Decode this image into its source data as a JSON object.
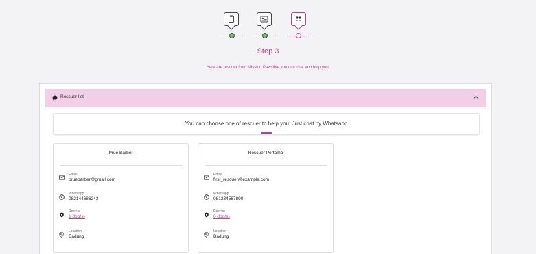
{
  "stepper": {
    "steps": [
      {
        "icon": "clipboard-icon",
        "state": "done"
      },
      {
        "icon": "id-card-icon",
        "state": "done"
      },
      {
        "icon": "users-icon",
        "state": "active"
      }
    ],
    "title": "Step 3",
    "subtitle": "Here are rescuer from Mission Pawsible you can chat and help you!"
  },
  "panel": {
    "title": "Rescuer list",
    "notice": "You can choose one of rescuer to help you. Just chat by Whatsapp"
  },
  "labels": {
    "email": "Email",
    "whatsapp": "Whatsapp",
    "rescue": "Rescue",
    "location": "Location"
  },
  "rescuers": [
    {
      "name": "Prue Barber",
      "email": "pruebarber@gmail.com",
      "whatsapp": "082144686243",
      "rescue": "1 dog(s)",
      "location": "Badung"
    },
    {
      "name": "Rescuer Pertama",
      "email": "first_rescuer@example.com",
      "whatsapp": "081234567890",
      "rescue": "0 dog(s)",
      "location": "Badung"
    }
  ],
  "colors": {
    "accent": "#c43c8f",
    "header_bg": "#f1cfe6",
    "done_dot": "#6fc06f"
  }
}
